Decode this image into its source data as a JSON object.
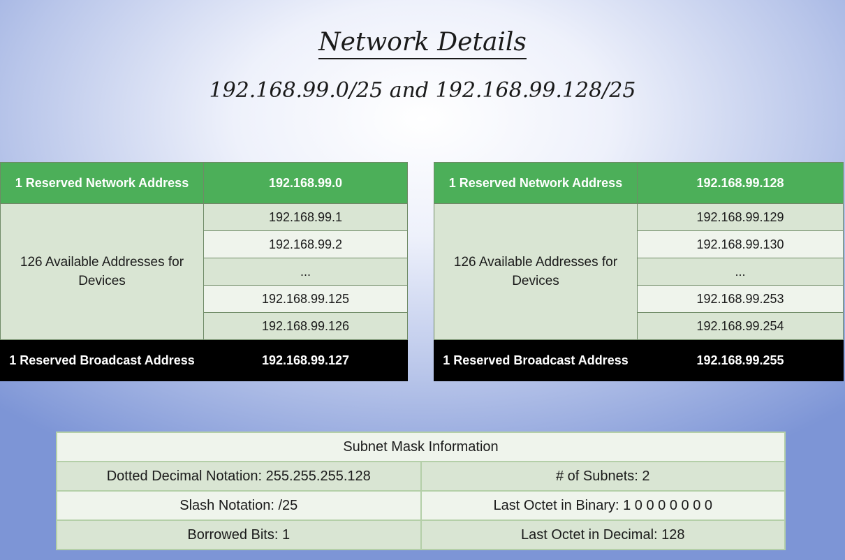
{
  "title": "Network Details",
  "subtitle": "192.168.99.0/25 and 192.168.99.128/25",
  "networks": [
    {
      "network_label": "1 Reserved Network Address",
      "network_address": "192.168.99.0",
      "available_label": "126 Available Addresses for Devices",
      "addresses": [
        "192.168.99.1",
        "192.168.99.2",
        "...",
        "192.168.99.125",
        "192.168.99.126"
      ],
      "broadcast_label": "1 Reserved Broadcast Address",
      "broadcast_address": "192.168.99.127"
    },
    {
      "network_label": "1 Reserved Network Address",
      "network_address": "192.168.99.128",
      "available_label": "126 Available Addresses for Devices",
      "addresses": [
        "192.168.99.129",
        "192.168.99.130",
        "...",
        "192.168.99.253",
        "192.168.99.254"
      ],
      "broadcast_label": "1 Reserved Broadcast Address",
      "broadcast_address": "192.168.99.255"
    }
  ],
  "mask": {
    "header": "Subnet Mask Information",
    "dotted": "Dotted Decimal Notation: 255.255.255.128",
    "subnets": "# of Subnets: 2",
    "slash": "Slash Notation: /25",
    "binary": "Last Octet in Binary: 1 0 0 0 0 0 0 0",
    "borrowed": "Borrowed Bits: 1",
    "decimal": "Last Octet in Decimal: 128"
  },
  "colors": {
    "network_row": "#4caf59",
    "broadcast_row": "#000000",
    "address_dark": "#d9e5d3",
    "address_light": "#eff4ec"
  }
}
